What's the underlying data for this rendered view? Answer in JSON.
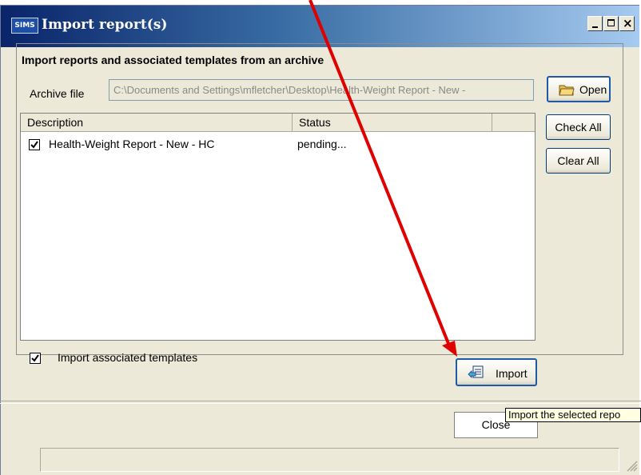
{
  "window": {
    "title": "Import report(s)",
    "logo_text": "SIMS"
  },
  "group": {
    "title": "Import reports and associated templates from an archive"
  },
  "archive": {
    "label": "Archive file",
    "value": "C:\\Documents and Settings\\mfletcher\\Desktop\\Health-Weight Report - New -"
  },
  "buttons": {
    "open": "Open",
    "check_all": "Check All",
    "clear_all": "Clear All",
    "import": "Import",
    "close": "Close"
  },
  "list": {
    "columns": [
      "Description",
      "Status",
      ""
    ],
    "rows": [
      {
        "checked": true,
        "description": "Health-Weight Report - New - HC",
        "status": "pending..."
      }
    ]
  },
  "options": {
    "import_templates_label": "Import associated templates",
    "import_templates_checked": true
  },
  "tooltip": {
    "text": "Import the selected repo"
  },
  "colors": {
    "annotation_arrow": "#e00000",
    "window_bg": "#ece9d8",
    "title_gradient_start": "#0a246a"
  },
  "icons": [
    "sims-logo",
    "minimize-icon",
    "maximize-icon",
    "close-icon",
    "open-folder-icon",
    "import-icon",
    "checkbox-checked-icon",
    "size-grip-icon"
  ]
}
